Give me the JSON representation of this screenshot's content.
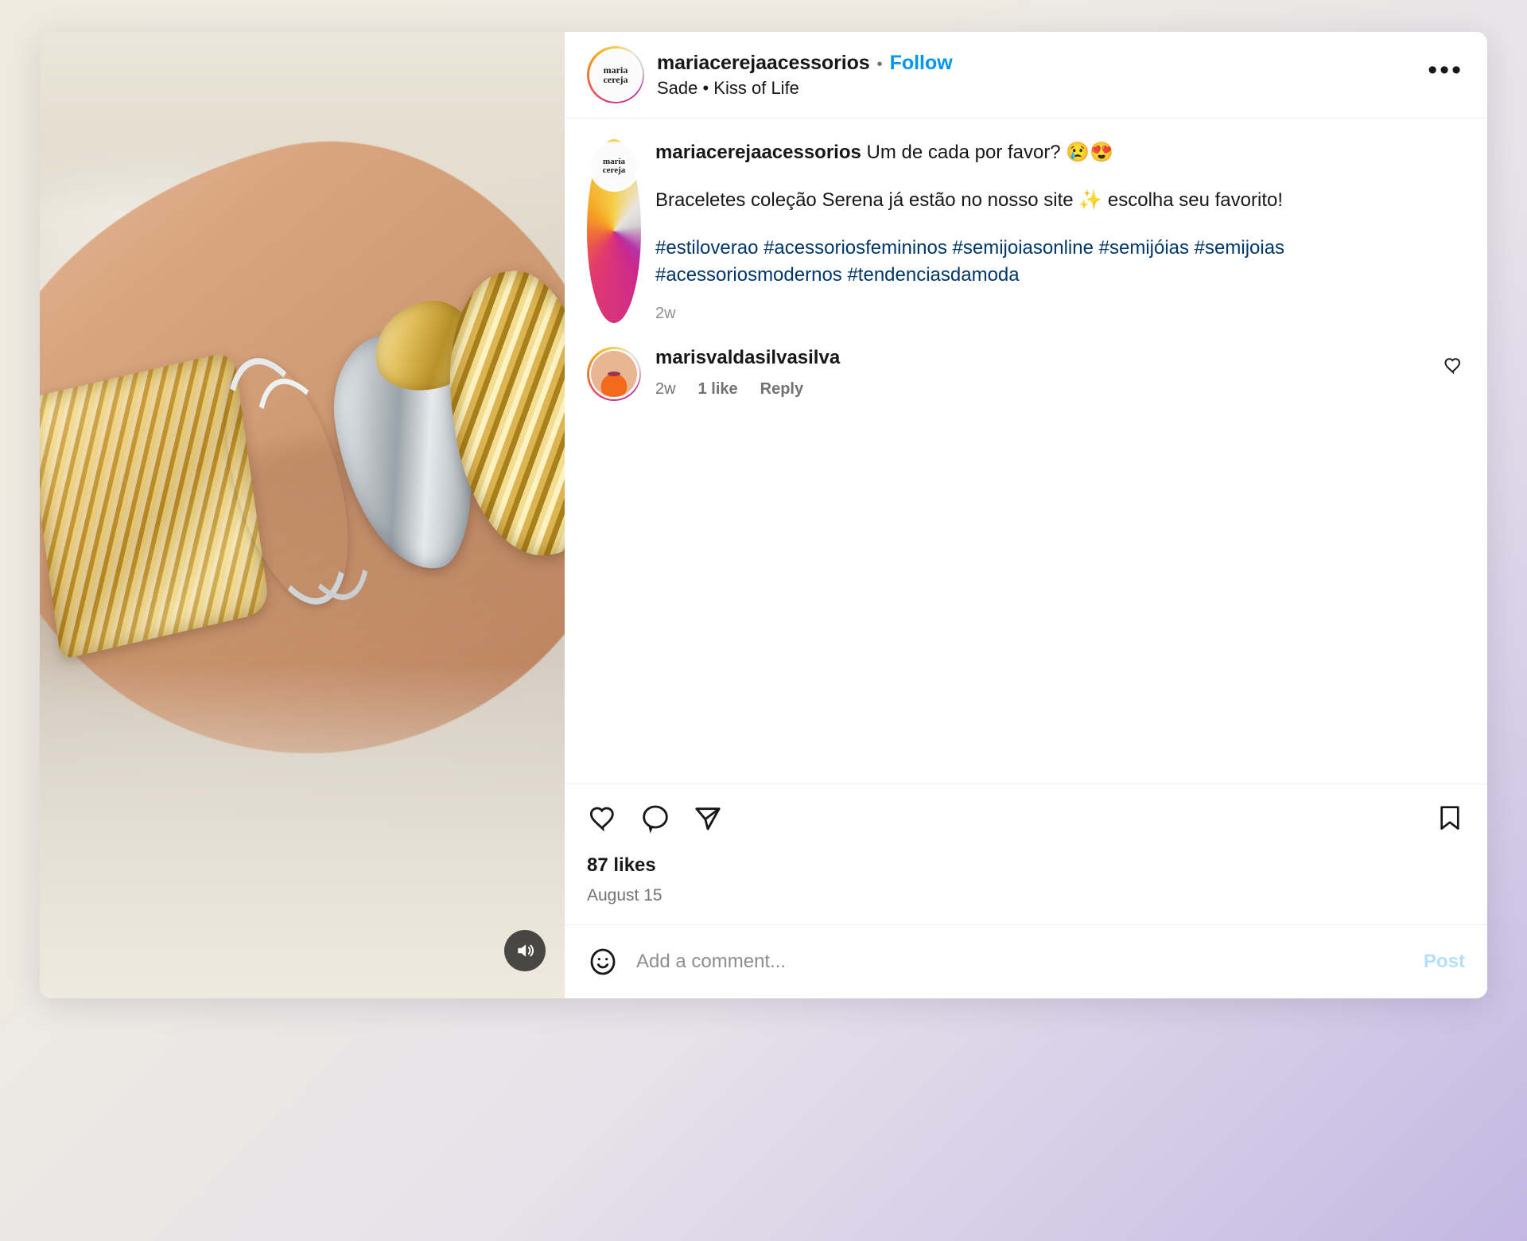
{
  "post": {
    "header": {
      "username": "mariacerejaacessorios",
      "separator": "•",
      "follow_label": "Follow",
      "audio": "Sade • Kiss of Life",
      "more_label": "•••",
      "avatar_line1": "maria",
      "avatar_line2": "cereja"
    },
    "caption": {
      "username": "mariacerejaacessorios",
      "line1": " Um de cada por favor? 😢😍",
      "paragraph": "Braceletes coleção Serena já estão no nosso site ✨ escolha seu favorito!",
      "hashtags": "#estiloverao #acessoriosfemininos #semijoiasonline #semijóias #semijoias #acessoriosmodernos #tendenciasdamoda",
      "time": "2w"
    },
    "comments": [
      {
        "username": "marisvaldasilvasilva",
        "time": "2w",
        "likes": "1 like",
        "reply_label": "Reply"
      }
    ],
    "actions": {
      "like_icon": "heart-icon",
      "comment_icon": "comment-icon",
      "share_icon": "share-icon",
      "save_icon": "bookmark-icon"
    },
    "stats": {
      "likes": "87 likes",
      "date": "August 15"
    },
    "add_comment": {
      "emoji_icon": "emoji-face-icon",
      "placeholder": "Add a comment...",
      "post_label": "Post"
    },
    "media": {
      "sound_icon": "sound-on-icon"
    },
    "colors": {
      "link_blue": "#0095f6",
      "hashtag_blue": "#00376b",
      "muted_grey": "#737373",
      "text_dark": "#171717",
      "post_disabled": "#b2dffc"
    }
  }
}
